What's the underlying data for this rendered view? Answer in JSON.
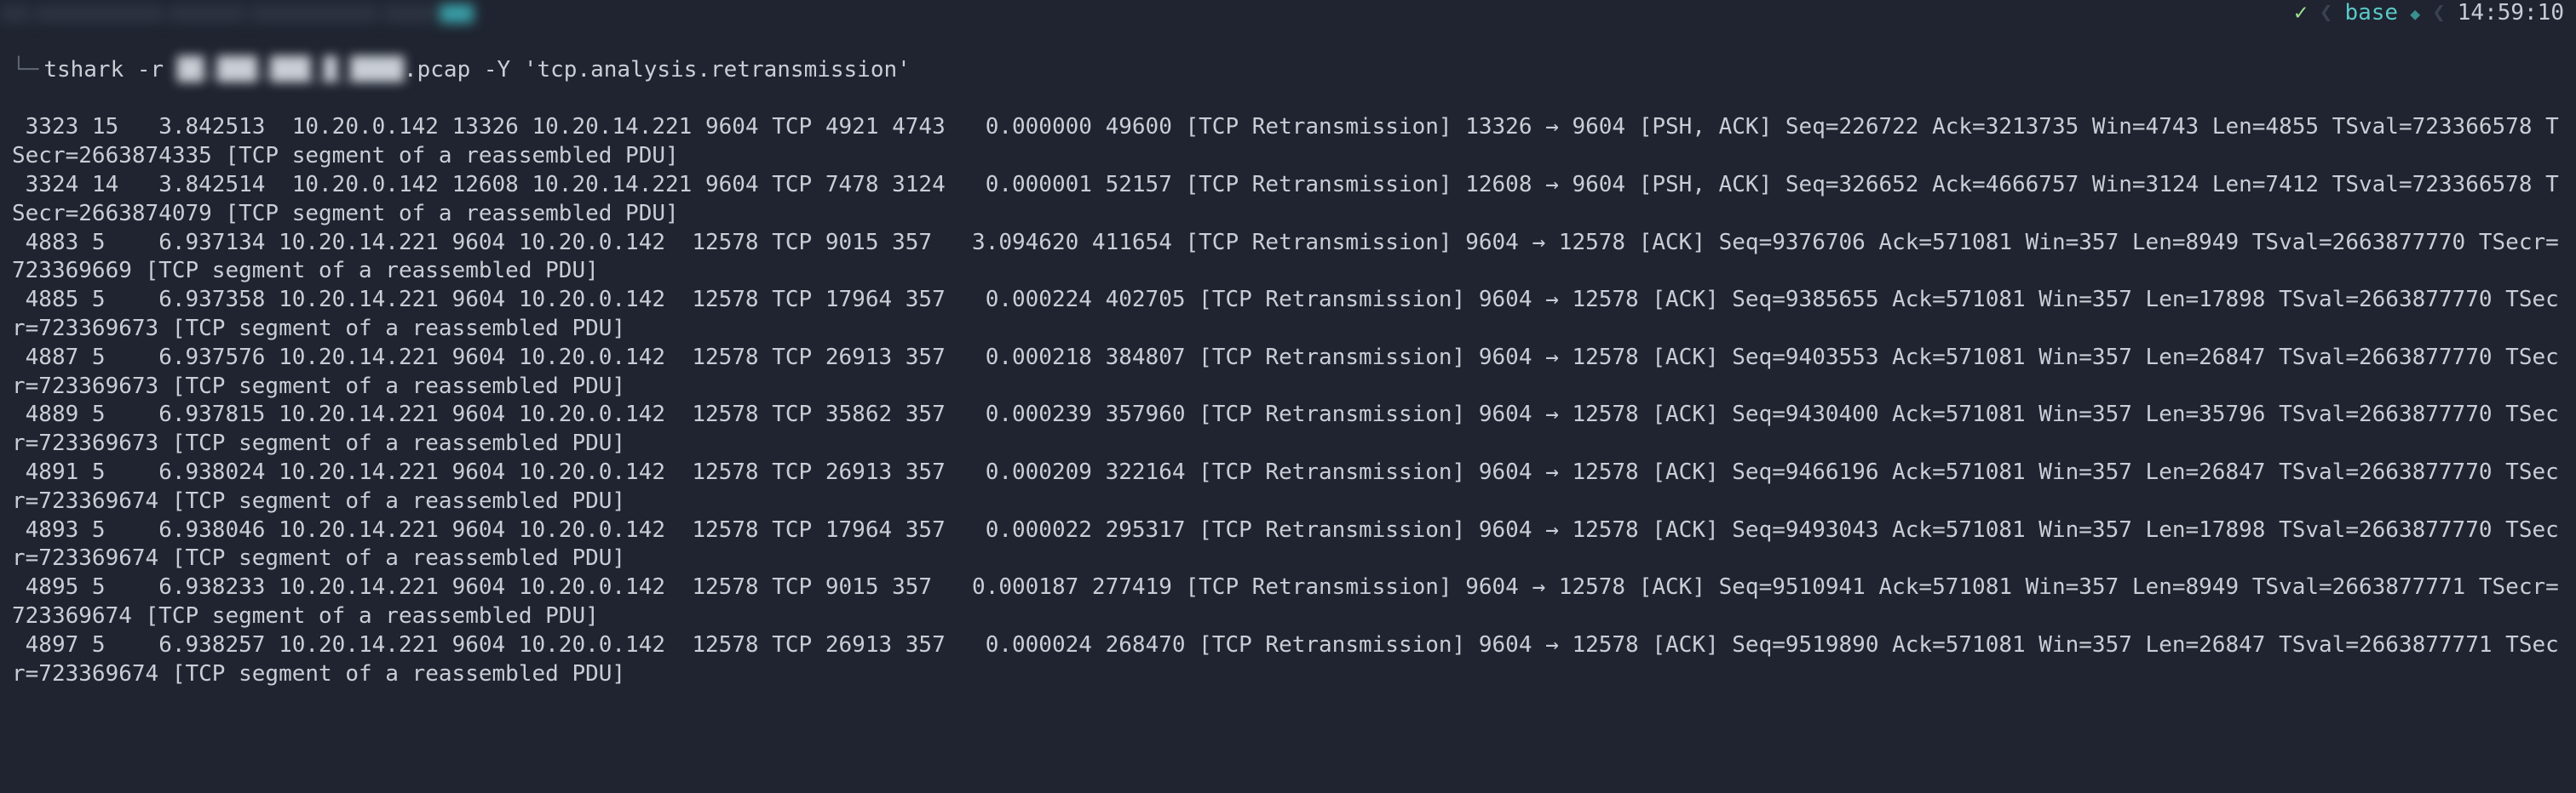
{
  "statusbar": {
    "check": "✓",
    "chev1": "❮",
    "env": "base",
    "diamond": "◆",
    "chev2": "❮",
    "clock": "14:59:10"
  },
  "prompt": {
    "branch_glyph": "└─",
    "cmd_prefix": "tshark -r ",
    "blurred_name": "██.███.███_█_████",
    "cmd_suffix": ".pcap -Y 'tcp.analysis.retransmission'"
  },
  "lines": [
    " 3323 15   3.842513  10.20.0.142 13326 10.20.14.221 9604 TCP 4921 4743   0.000000 49600 [TCP Retransmission] 13326 → 9604 [PSH, ACK] Seq=226722 Ack=3213735 Win=4743 Len=4855 TSval=723366578 TSecr=2663874335 [TCP segment of a reassembled PDU]",
    " 3324 14   3.842514  10.20.0.142 12608 10.20.14.221 9604 TCP 7478 3124   0.000001 52157 [TCP Retransmission] 12608 → 9604 [PSH, ACK] Seq=326652 Ack=4666757 Win=3124 Len=7412 TSval=723366578 TSecr=2663874079 [TCP segment of a reassembled PDU]",
    " 4883 5    6.937134 10.20.14.221 9604 10.20.0.142  12578 TCP 9015 357   3.094620 411654 [TCP Retransmission] 9604 → 12578 [ACK] Seq=9376706 Ack=571081 Win=357 Len=8949 TSval=2663877770 TSecr=723369669 [TCP segment of a reassembled PDU]",
    " 4885 5    6.937358 10.20.14.221 9604 10.20.0.142  12578 TCP 17964 357   0.000224 402705 [TCP Retransmission] 9604 → 12578 [ACK] Seq=9385655 Ack=571081 Win=357 Len=17898 TSval=2663877770 TSecr=723369673 [TCP segment of a reassembled PDU]",
    " 4887 5    6.937576 10.20.14.221 9604 10.20.0.142  12578 TCP 26913 357   0.000218 384807 [TCP Retransmission] 9604 → 12578 [ACK] Seq=9403553 Ack=571081 Win=357 Len=26847 TSval=2663877770 TSecr=723369673 [TCP segment of a reassembled PDU]",
    " 4889 5    6.937815 10.20.14.221 9604 10.20.0.142  12578 TCP 35862 357   0.000239 357960 [TCP Retransmission] 9604 → 12578 [ACK] Seq=9430400 Ack=571081 Win=357 Len=35796 TSval=2663877770 TSecr=723369673 [TCP segment of a reassembled PDU]",
    " 4891 5    6.938024 10.20.14.221 9604 10.20.0.142  12578 TCP 26913 357   0.000209 322164 [TCP Retransmission] 9604 → 12578 [ACK] Seq=9466196 Ack=571081 Win=357 Len=26847 TSval=2663877770 TSecr=723369674 [TCP segment of a reassembled PDU]",
    " 4893 5    6.938046 10.20.14.221 9604 10.20.0.142  12578 TCP 17964 357   0.000022 295317 [TCP Retransmission] 9604 → 12578 [ACK] Seq=9493043 Ack=571081 Win=357 Len=17898 TSval=2663877770 TSecr=723369674 [TCP segment of a reassembled PDU]",
    " 4895 5    6.938233 10.20.14.221 9604 10.20.0.142  12578 TCP 9015 357   0.000187 277419 [TCP Retransmission] 9604 → 12578 [ACK] Seq=9510941 Ack=571081 Win=357 Len=8949 TSval=2663877771 TSecr=723369674 [TCP segment of a reassembled PDU]",
    " 4897 5    6.938257 10.20.14.221 9604 10.20.0.142  12578 TCP 26913 357   0.000024 268470 [TCP Retransmission] 9604 → 12578 [ACK] Seq=9519890 Ack=571081 Win=357 Len=26847 TSval=2663877771 TSecr=723369674 [TCP segment of a reassembled PDU]"
  ]
}
